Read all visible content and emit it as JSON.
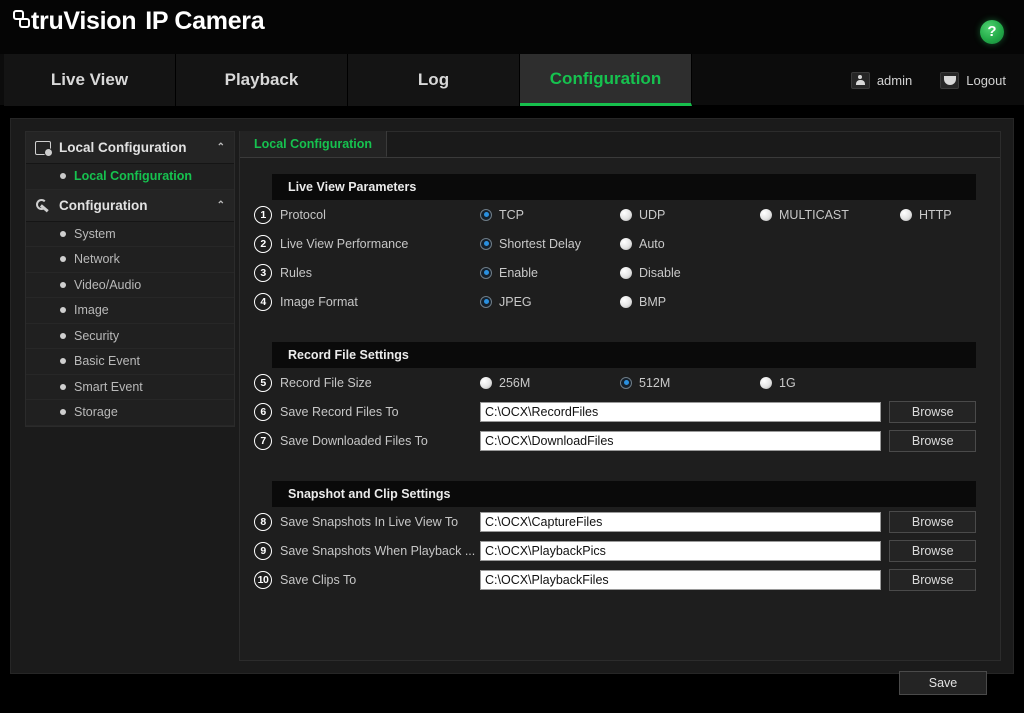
{
  "brand": {
    "name": "truVision",
    "product": "IP Camera",
    "logo_icon": "truvision-logo-icon",
    "help_icon": "help-question-icon",
    "help_label": "?",
    "accent_green": "#16c24f"
  },
  "nav": {
    "tabs": [
      {
        "label": "Live View",
        "active": false
      },
      {
        "label": "Playback",
        "active": false
      },
      {
        "label": "Log",
        "active": false
      },
      {
        "label": "Configuration",
        "active": true
      }
    ],
    "account": {
      "user_icon": "user-avatar-icon",
      "user": "admin",
      "logout_icon": "logout-icon",
      "logout": "Logout"
    }
  },
  "sidebar": {
    "groups": [
      {
        "icon": "monitor-icon",
        "label": "Local Configuration",
        "caret": "⌃",
        "items": [
          {
            "label": "Local Configuration",
            "selected": true
          }
        ]
      },
      {
        "icon": "wrench-icon",
        "label": "Configuration",
        "caret": "⌃",
        "items": [
          {
            "label": "System",
            "selected": false
          },
          {
            "label": "Network",
            "selected": false
          },
          {
            "label": "Video/Audio",
            "selected": false
          },
          {
            "label": "Image",
            "selected": false
          },
          {
            "label": "Security",
            "selected": false
          },
          {
            "label": "Basic Event",
            "selected": false
          },
          {
            "label": "Smart Event",
            "selected": false
          },
          {
            "label": "Storage",
            "selected": false
          }
        ]
      }
    ]
  },
  "content": {
    "inner_tab": "Local Configuration",
    "sections": [
      {
        "title": "Live View Parameters",
        "rows": [
          {
            "marker": "1",
            "label": "Protocol",
            "type": "radio",
            "options": [
              {
                "label": "TCP",
                "selected": true
              },
              {
                "label": "UDP",
                "selected": false
              },
              {
                "label": "MULTICAST",
                "selected": false
              },
              {
                "label": "HTTP",
                "selected": false
              }
            ]
          },
          {
            "marker": "2",
            "label": "Live View Performance",
            "type": "radio",
            "options": [
              {
                "label": "Shortest Delay",
                "selected": true
              },
              {
                "label": "Auto",
                "selected": false
              }
            ]
          },
          {
            "marker": "3",
            "label": "Rules",
            "type": "radio",
            "options": [
              {
                "label": "Enable",
                "selected": true
              },
              {
                "label": "Disable",
                "selected": false
              }
            ]
          },
          {
            "marker": "4",
            "label": "Image Format",
            "type": "radio",
            "options": [
              {
                "label": "JPEG",
                "selected": true
              },
              {
                "label": "BMP",
                "selected": false
              }
            ]
          }
        ]
      },
      {
        "title": "Record File Settings",
        "rows": [
          {
            "marker": "5",
            "label": "Record File Size",
            "type": "radio",
            "options": [
              {
                "label": "256M",
                "selected": false
              },
              {
                "label": "512M",
                "selected": true
              },
              {
                "label": "1G",
                "selected": false
              }
            ]
          },
          {
            "marker": "6",
            "label": "Save Record Files To",
            "type": "path",
            "value": "C:\\OCX\\RecordFiles",
            "button": "Browse"
          },
          {
            "marker": "7",
            "label": "Save Downloaded Files To",
            "type": "path",
            "value": "C:\\OCX\\DownloadFiles",
            "button": "Browse"
          }
        ]
      },
      {
        "title": "Snapshot and Clip Settings",
        "rows": [
          {
            "marker": "8",
            "label": "Save Snapshots In Live View To",
            "type": "path",
            "value": "C:\\OCX\\CaptureFiles",
            "button": "Browse"
          },
          {
            "marker": "9",
            "label": "Save Snapshots When Playback ...",
            "type": "path",
            "value": "C:\\OCX\\PlaybackPics",
            "button": "Browse"
          },
          {
            "marker": "10",
            "label": "Save Clips To",
            "type": "path",
            "value": "C:\\OCX\\PlaybackFiles",
            "button": "Browse"
          }
        ]
      }
    ],
    "save_label": "Save"
  }
}
